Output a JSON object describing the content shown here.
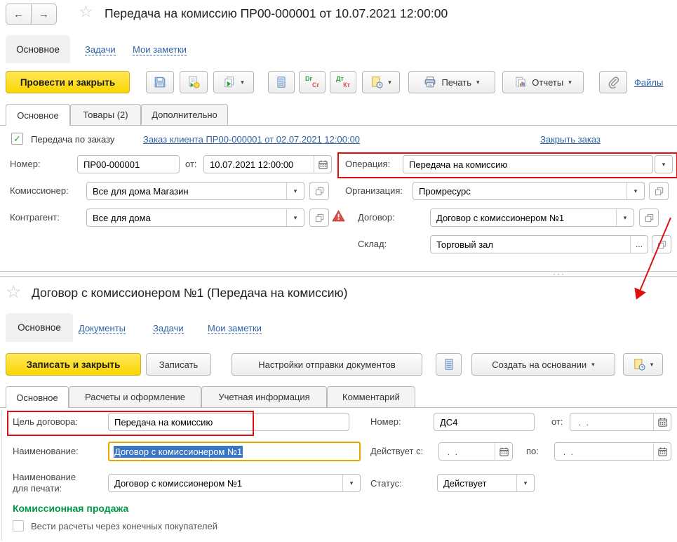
{
  "icons": {
    "back": "←",
    "forward": "→",
    "star": "☆",
    "caret": "▾",
    "ellipsis": "...",
    "grip": "···",
    "check": "✓"
  },
  "top_window": {
    "title": "Передача на комиссию ПР00-000001 от 10.07.2021 12:00:00",
    "nav": {
      "main": "Основное",
      "tasks": "Задачи",
      "notes": "Мои заметки"
    },
    "toolbar": {
      "post_close": "Провести и закрыть",
      "print": "Печать",
      "reports": "Отчеты",
      "files": "Файлы",
      "drcr": {
        "dr": "Dr",
        "cr": "Cr"
      },
      "dtkt": {
        "dt": "Дт",
        "kt": "Кт"
      }
    },
    "tabs": {
      "main": "Основное",
      "goods": "Товары (2)",
      "extra": "Дополнительно"
    },
    "order": {
      "checkbox": "Передача по заказу",
      "link": "Заказ клиента ПР00-000001 от 02.07.2021 12:00:00",
      "close": "Закрыть заказ"
    },
    "fields": {
      "number": {
        "label": "Номер:",
        "value": "ПР00-000001"
      },
      "date": {
        "label": "от:",
        "value": "10.07.2021 12:00:00"
      },
      "operation": {
        "label": "Операция:",
        "value": "Передача на комиссию"
      },
      "commissioner": {
        "label": "Комиссионер:",
        "value": "Все для дома Магазин"
      },
      "organization": {
        "label": "Организация:",
        "value": "Промресурс"
      },
      "counterparty": {
        "label": "Контрагент:",
        "value": "Все для дома"
      },
      "contract": {
        "label": "Договор:",
        "value": "Договор с комиссионером №1"
      },
      "warehouse": {
        "label": "Склад:",
        "value": "Торговый зал"
      }
    }
  },
  "bottom_window": {
    "title": "Договор с комиссионером №1  (Передача на комиссию)",
    "nav": {
      "main": "Основное",
      "documents": "Документы",
      "tasks": "Задачи",
      "notes": "Мои заметки"
    },
    "toolbar": {
      "save_close": "Записать и закрыть",
      "save": "Записать",
      "send_settings": "Настройки отправки документов",
      "create_based": "Создать на основании"
    },
    "tabs": {
      "main": "Основное",
      "calc": "Расчеты и оформление",
      "accounting": "Учетная информация",
      "comment": "Комментарий"
    },
    "fields": {
      "purpose": {
        "label": "Цель договора:",
        "value": "Передача на комиссию"
      },
      "number": {
        "label": "Номер:",
        "value": "ДС4"
      },
      "from": {
        "label": "от:",
        "value": " .  ."
      },
      "name": {
        "label": "Наименование:",
        "value": "Договор с комиссионером №1"
      },
      "valid_from": {
        "label": "Действует с:",
        "value": " .  ."
      },
      "valid_to": {
        "label": "по:",
        "value": " .  ."
      },
      "print_name": {
        "label_line1": "Наименование",
        "label_line2": "для печати:",
        "value": "Договор с комиссионером №1"
      },
      "status": {
        "label": "Статус:",
        "value": "Действует"
      }
    },
    "commission_section": {
      "heading": "Комиссионная продажа",
      "checkbox": "Вести расчеты через конечных покупателей"
    }
  },
  "colors": {
    "accent_yellow": "#fbd500",
    "link_blue": "#2f63a7",
    "annotation_red": "#e01010",
    "section_green": "#009846",
    "selection_blue": "#3a76c4",
    "focus_orange": "#e7a500"
  }
}
